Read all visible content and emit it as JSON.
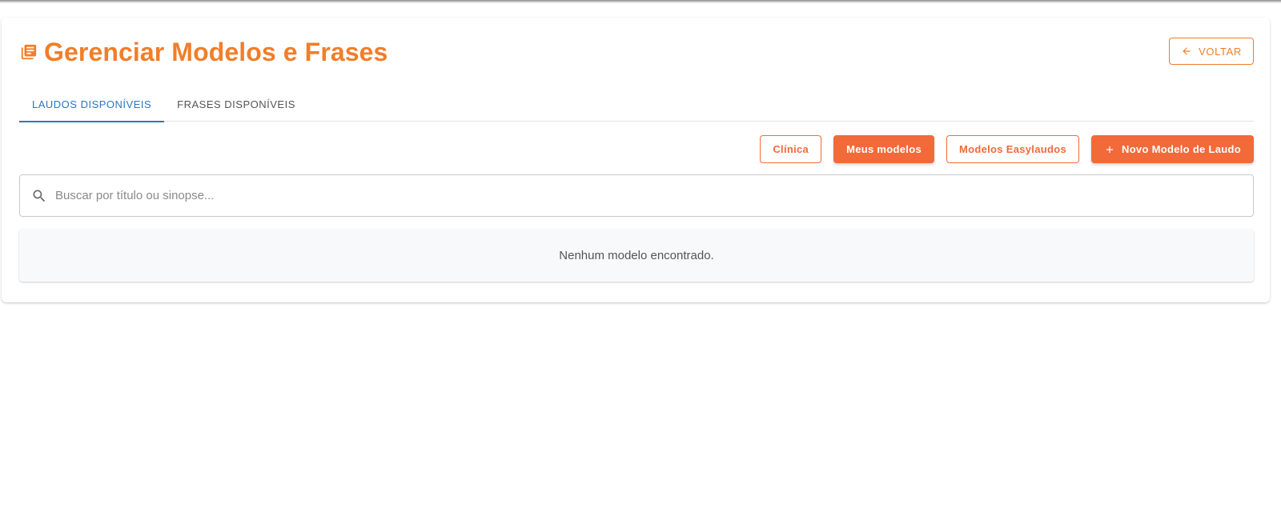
{
  "header": {
    "title": "Gerenciar Modelos e Frases",
    "title_icon": "library-books-icon",
    "back_label": "VOLTAR",
    "back_icon": "arrow-left-icon"
  },
  "tabs": [
    {
      "label": "LAUDOS DISPONÍVEIS",
      "active": true
    },
    {
      "label": "FRASES DISPONÍVEIS",
      "active": false
    }
  ],
  "actions": {
    "clinica_label": "Clínica",
    "meus_modelos_label": "Meus modelos",
    "modelos_easylaudos_label": "Modelos Easylaudos",
    "novo_modelo_label": "Novo Modelo de Laudo",
    "novo_modelo_icon": "plus-icon"
  },
  "search": {
    "placeholder": "Buscar por título ou sinopse...",
    "value": "",
    "icon": "search-icon"
  },
  "results": {
    "empty_message": "Nenhum modelo encontrado."
  },
  "colors": {
    "title_orange": "#f07e2a",
    "button_orange": "#f26a3a",
    "tab_active_blue": "#2b77c4"
  }
}
